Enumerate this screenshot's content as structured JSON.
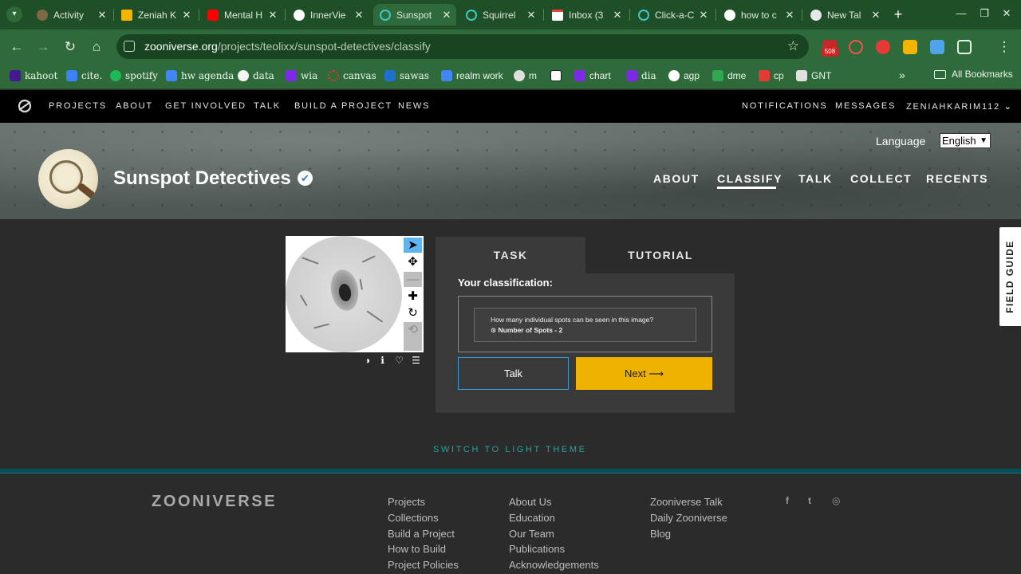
{
  "browser": {
    "tabs": [
      {
        "title": "Activity",
        "active": false
      },
      {
        "title": "Zeniah K",
        "active": false
      },
      {
        "title": "Mental H",
        "active": false
      },
      {
        "title": "InnerVie",
        "active": false
      },
      {
        "title": "Sunspot",
        "active": true
      },
      {
        "title": "Squirrel",
        "active": false
      },
      {
        "title": "Inbox (3",
        "active": false
      },
      {
        "title": "Click-a-C",
        "active": false
      },
      {
        "title": "how to c",
        "active": false
      },
      {
        "title": "New Tal",
        "active": false
      }
    ],
    "close_glyph": "✕",
    "new_tab_glyph": "+",
    "url_host": "zooniverse.org",
    "url_path": "/projects/teolixx/sunspot-detectives/classify",
    "extension_badge": "508",
    "bookmarks": [
      {
        "label": "kahoot",
        "icon": "kahoot-icon",
        "color": "#46178f"
      },
      {
        "label": "cite.",
        "icon": "cite-icon",
        "color": "#3b82f6"
      },
      {
        "label": "spotify",
        "icon": "spotify-icon",
        "color": "#1db954"
      },
      {
        "label": "hw agenda",
        "icon": "docs-icon",
        "color": "#4285f4"
      },
      {
        "label": "data",
        "icon": "data-icon",
        "color": "#f5f5f5"
      },
      {
        "label": "wia",
        "icon": "canva-icon",
        "color": "#7d2ae8"
      },
      {
        "label": "canvas",
        "icon": "canvas-icon",
        "color": "#e13a1e"
      },
      {
        "label": "sawas",
        "icon": "savvas-icon",
        "color": "#1f6fd0"
      },
      {
        "label": "realm work",
        "icon": "docs-icon",
        "color": "#4285f4"
      },
      {
        "label": "m",
        "icon": "m-icon",
        "color": "#e0e0e0"
      },
      {
        "label": "",
        "icon": "notion-icon",
        "color": "#ffffff"
      },
      {
        "label": "chart",
        "icon": "canva-icon",
        "color": "#7d2ae8"
      },
      {
        "label": "dia",
        "icon": "canva-icon",
        "color": "#7d2ae8"
      },
      {
        "label": "agp",
        "icon": "globe-icon",
        "color": "#ffffff"
      },
      {
        "label": "dme",
        "icon": "dme-icon",
        "color": "#2fa84f"
      },
      {
        "label": "cp",
        "icon": "cp-icon",
        "color": "#e53935"
      },
      {
        "label": "GNT",
        "icon": "gnt-icon",
        "color": "#e0e0e0"
      }
    ],
    "bookmarks_more": "»",
    "all_bookmarks": "All Bookmarks"
  },
  "zoo_nav": {
    "left": [
      "PROJECTS",
      "ABOUT",
      "GET INVOLVED",
      "TALK",
      "BUILD A PROJECT",
      "NEWS"
    ],
    "right": [
      "NOTIFICATIONS",
      "MESSAGES",
      "ZENIAHKARIM112"
    ]
  },
  "project": {
    "title": "Sunspot Detectives",
    "verified_glyph": "✔",
    "language_label": "Language",
    "language_value": "English",
    "nav": [
      "ABOUT",
      "CLASSIFY",
      "TALK",
      "COLLECT",
      "RECENTS"
    ],
    "active_nav": "CLASSIFY"
  },
  "classifier": {
    "tabs": [
      "TASK",
      "TUTORIAL"
    ],
    "your_classification": "Your classification:",
    "question": "How many individual spots can be seen in this image?",
    "answer": "Number of Spots - 2",
    "talk_button": "Talk",
    "next_button": "Next",
    "next_arrow": "⟶",
    "tools": [
      {
        "name": "pointer-tool-icon",
        "glyph": "➤",
        "state": "selected"
      },
      {
        "name": "move-tool-icon",
        "glyph": "✥",
        "state": "normal"
      },
      {
        "name": "zoom-out-icon",
        "glyph": "—",
        "state": "disabled"
      },
      {
        "name": "zoom-in-icon",
        "glyph": "✚",
        "state": "normal"
      },
      {
        "name": "rotate-icon",
        "glyph": "↻",
        "state": "normal"
      },
      {
        "name": "reset-icon",
        "glyph": "⟲",
        "state": "disabled"
      }
    ],
    "subject_controls": [
      {
        "name": "invert-icon",
        "glyph": "◑"
      },
      {
        "name": "info-icon",
        "glyph": "ℹ"
      },
      {
        "name": "favorite-icon",
        "glyph": "♡"
      },
      {
        "name": "collections-icon",
        "glyph": "☰"
      }
    ],
    "field_guide": "FIELD GUIDE",
    "switch_theme": "SWITCH TO LIGHT THEME"
  },
  "footer": {
    "logo": "ZOONIVERSE",
    "col1": [
      "Projects",
      "Collections",
      "Build a Project",
      "How to Build",
      "Project Policies"
    ],
    "col2": [
      "About Us",
      "Education",
      "Our Team",
      "Publications",
      "Acknowledgements"
    ],
    "col3": [
      "Zooniverse Talk",
      "Daily Zooniverse",
      "Blog"
    ],
    "social": [
      {
        "name": "facebook-icon",
        "glyph": "f"
      },
      {
        "name": "twitter-icon",
        "glyph": "t"
      },
      {
        "name": "instagram-icon",
        "glyph": "◎"
      }
    ]
  }
}
